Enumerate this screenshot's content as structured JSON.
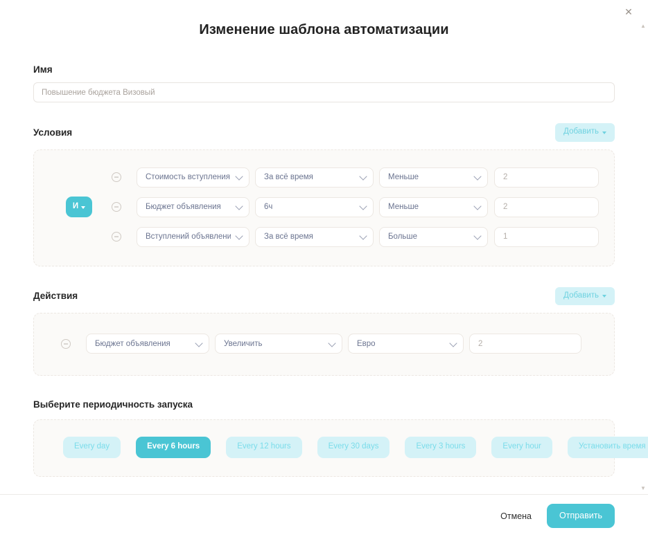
{
  "dialog": {
    "title": "Изменение шаблона автоматизации",
    "close_icon": "close-icon"
  },
  "name_field": {
    "label": "Имя",
    "value": "",
    "placeholder": "Повышение бюджета Визовый"
  },
  "conditions": {
    "title": "Условия",
    "add_label": "Добавить",
    "logic_operator": "И",
    "rows": [
      {
        "metric": "Стоимость вступления (CPF)",
        "period": "За всё время",
        "comparator": "Меньше",
        "value": "",
        "value_placeholder": "2"
      },
      {
        "metric": "Бюджет объявления",
        "period": "6ч",
        "comparator": "Меньше",
        "value": "",
        "value_placeholder": "2"
      },
      {
        "metric": "Вступлений объявления",
        "period": "За всё время",
        "comparator": "Больше",
        "value": "",
        "value_placeholder": "1"
      }
    ]
  },
  "actions": {
    "title": "Действия",
    "add_label": "Добавить",
    "rows": [
      {
        "target": "Бюджет объявления",
        "operation": "Увеличить",
        "unit": "Евро",
        "value": "",
        "value_placeholder": "2"
      }
    ]
  },
  "schedule": {
    "title": "Выберите периодичность запуска",
    "options": [
      {
        "label": "Every day",
        "selected": false
      },
      {
        "label": "Every 6 hours",
        "selected": true
      },
      {
        "label": "Every 12 hours",
        "selected": false
      },
      {
        "label": "Every 30 days",
        "selected": false
      },
      {
        "label": "Every 3 hours",
        "selected": false
      },
      {
        "label": "Every hour",
        "selected": false
      },
      {
        "label": "Установить время",
        "selected": false
      }
    ]
  },
  "footer": {
    "cancel_label": "Отмена",
    "submit_label": "Отправить"
  },
  "colors": {
    "accent": "#4ac5d4",
    "accent_soft": "#d4f2f7",
    "accent_text": "#7adcea",
    "panel_bg": "#fbfaf8",
    "panel_border": "#ece7e2",
    "select_text": "#6b7490"
  }
}
